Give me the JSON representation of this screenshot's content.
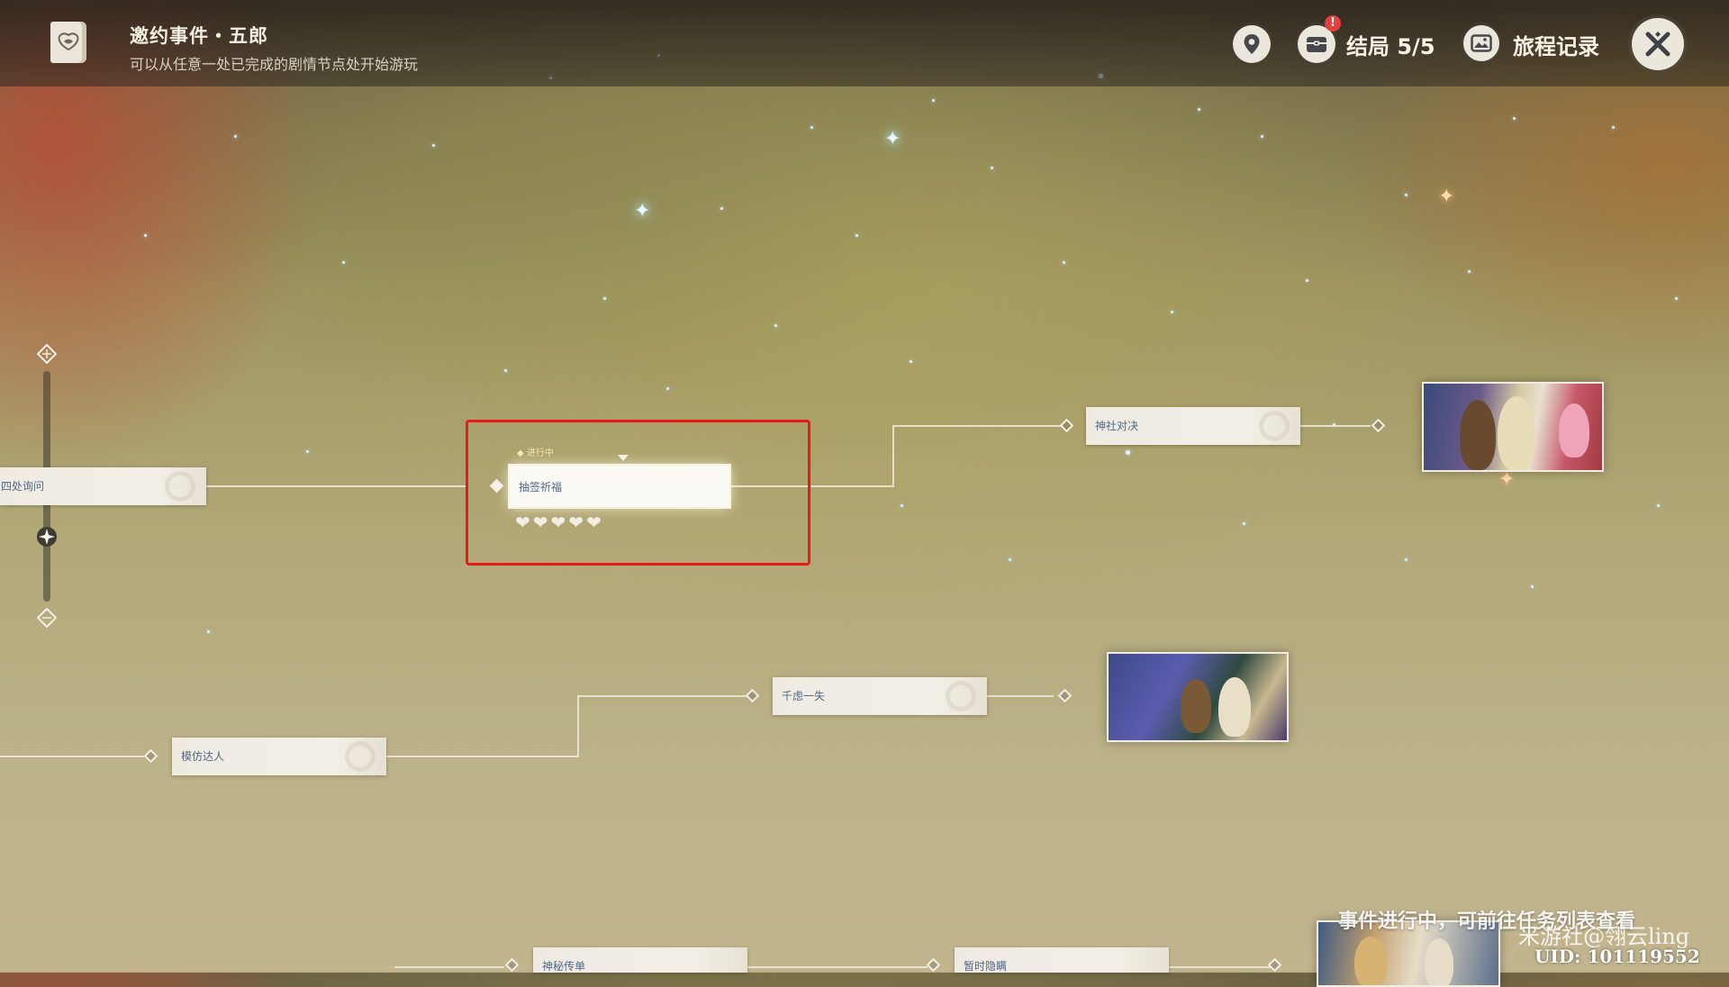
{
  "header": {
    "title": "邀约事件・五郎",
    "subtitle": "可以从任意一处已完成的剧情节点处开始游玩",
    "ending_label": "结局 5/5",
    "journey_label": "旅程记录",
    "alert": "!"
  },
  "icons": [
    "book-icon",
    "map-pin-icon",
    "ending-chest-icon",
    "photo-icon",
    "close-icon"
  ],
  "nodes": {
    "ask_around": "四处询问",
    "draw_fortune": "抽签祈福",
    "shrine_duel": "神社对决",
    "slip": "千虑一失",
    "imitation": "模仿达人",
    "mystery_flyer": "神秘传单",
    "hide": "暂时隐瞒"
  },
  "active": {
    "status": "◆ 进行中",
    "hearts": 5
  },
  "footer": {
    "message": "事件进行中，可前往任务列表查看",
    "watermark": "米游社@翎云ling",
    "uid": "UID: 101119552"
  },
  "colors": {
    "highlight_box": "#e81a1a",
    "node_text": "#4e6987"
  }
}
